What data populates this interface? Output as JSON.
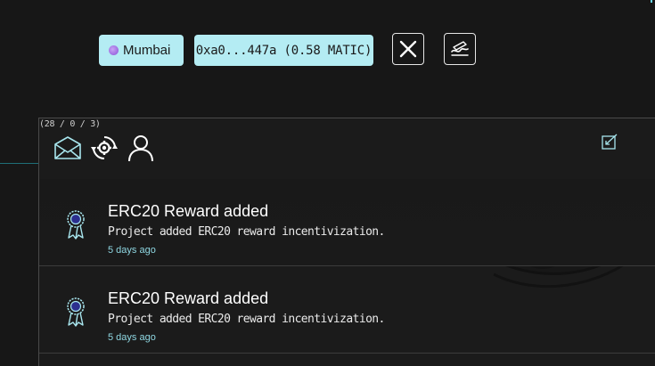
{
  "header": {
    "network_label": "Mumbai",
    "account_label": "0xa0...447a (0.58 MATIC)"
  },
  "panel": {
    "counts": "(28 / 0 / 3)"
  },
  "notifications": [
    {
      "title": "ERC20 Reward added",
      "description": "Project added ERC20 reward incentivization.",
      "time": "5 days ago"
    },
    {
      "title": "ERC20 Reward added",
      "description": "Project added ERC20 reward incentivization.",
      "time": "5 days ago"
    }
  ],
  "icons": {
    "network": "polygon-dot-icon",
    "close": "close-icon",
    "sign": "signature-icon",
    "inbox": "envelope-icon",
    "refresh": "refresh-gear-icon",
    "profile": "user-icon",
    "mark_read": "mark-read-icon",
    "item": "award-ribbon-icon"
  },
  "colors": {
    "accent": "#b4ecf3",
    "time_text": "#8fd7e2",
    "background": "#171717"
  }
}
